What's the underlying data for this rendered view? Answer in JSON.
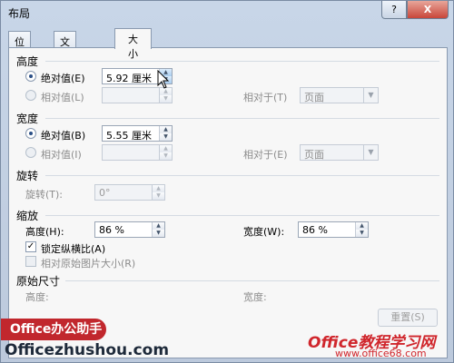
{
  "window": {
    "title": "布局",
    "help_label": "?",
    "close_label": "X"
  },
  "tabs": [
    {
      "label": "位置",
      "active": false
    },
    {
      "label": "文字环绕",
      "active": false
    },
    {
      "label": "大小",
      "active": true
    }
  ],
  "height": {
    "section_title": "高度",
    "absolute_label": "绝对值(E)",
    "absolute_value": "5.92 厘米",
    "relative_label": "相对值(L)",
    "relative_to_label": "相对于(T)",
    "relative_to_value": "页面"
  },
  "width": {
    "section_title": "宽度",
    "absolute_label": "绝对值(B)",
    "absolute_value": "5.55 厘米",
    "relative_label": "相对值(I)",
    "relative_to_label": "相对于(E)",
    "relative_to_value": "页面"
  },
  "rotate": {
    "section_title": "旋转",
    "rotation_label": "旋转(T):",
    "rotation_value": "0°"
  },
  "scale": {
    "section_title": "缩放",
    "height_label": "高度(H):",
    "height_value": "86 %",
    "width_label": "宽度(W):",
    "width_value": "86 %",
    "lock_aspect_label": "锁定纵横比(A)",
    "lock_aspect_checked": true,
    "relative_original_label": "相对原始图片大小(R)",
    "relative_original_checked": false
  },
  "original_size": {
    "section_title": "原始尺寸",
    "height_label": "高度:",
    "width_label": "宽度:",
    "reset_label": "重置(S)"
  },
  "watermarks": {
    "badge": "Office办公助手",
    "site": "Officezhushou.com",
    "brand": "Office教程学习网",
    "brand_url": "www.office68.com"
  },
  "icons": {
    "spin_up": "triangle-up-icon",
    "spin_down": "triangle-down-icon",
    "dropdown": "chevron-down-icon",
    "cursor": "mouse-pointer-icon"
  }
}
